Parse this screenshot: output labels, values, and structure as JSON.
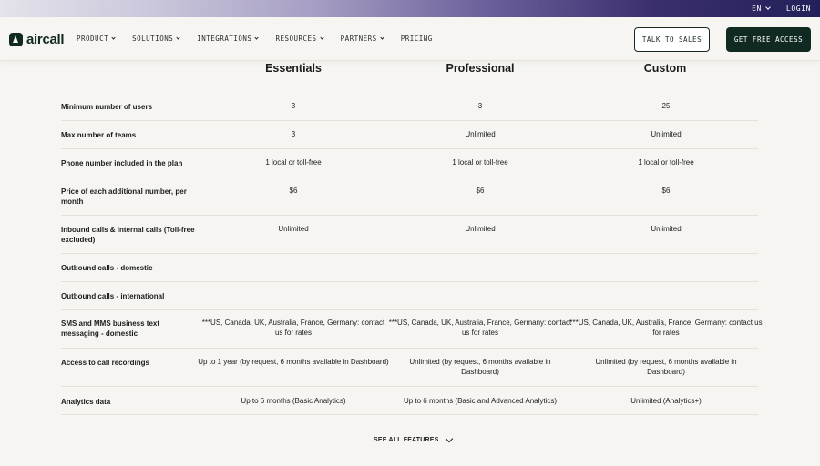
{
  "topbar": {
    "language": "EN",
    "login": "LOGIN"
  },
  "nav": {
    "logo_text": "aircall",
    "items": [
      {
        "label": "PRODUCT",
        "has_dropdown": true
      },
      {
        "label": "SOLUTIONS",
        "has_dropdown": true
      },
      {
        "label": "INTEGRATIONS",
        "has_dropdown": true
      },
      {
        "label": "RESOURCES",
        "has_dropdown": true
      },
      {
        "label": "PARTNERS",
        "has_dropdown": true
      },
      {
        "label": "PRICING",
        "has_dropdown": false
      }
    ],
    "talk_to_sales": "TALK TO SALES",
    "get_free_access": "GET FREE ACCESS"
  },
  "plans": [
    "Essentials",
    "Professional",
    "Custom"
  ],
  "rows": [
    {
      "label": "Minimum number of users",
      "values": [
        "3",
        "3",
        "25"
      ]
    },
    {
      "label": "Max number of teams",
      "values": [
        "3",
        "Unlimited",
        "Unlimited"
      ]
    },
    {
      "label": "Phone number included in the plan",
      "values": [
        "1 local or toll-free",
        "1 local or toll-free",
        "1 local or toll-free"
      ]
    },
    {
      "label": "Price of each additional number, per month",
      "values": [
        "$6",
        "$6",
        "$6"
      ]
    },
    {
      "label": "Inbound calls & internal calls (Toll-free excluded)",
      "values": [
        "Unlimited",
        "Unlimited",
        "Unlimited"
      ]
    },
    {
      "label": "Outbound calls - domestic",
      "values": [
        "",
        "",
        ""
      ]
    },
    {
      "label": "Outbound calls - international",
      "values": [
        "",
        "",
        ""
      ]
    },
    {
      "label": "SMS and MMS business text messaging - domestic",
      "values": [
        "***US, Canada, UK, Australia, France, Germany: contact us for rates",
        "***US, Canada, UK, Australia, France, Germany: contact us for rates",
        "***US, Canada, UK, Australia, France, Germany: contact us for rates"
      ]
    },
    {
      "label": "Access to call recordings",
      "values": [
        "Up to 1 year (by request, 6 months available in Dashboard)",
        "Unlimited (by request, 6 months available in Dashboard)",
        "Unlimited (by request, 6 months available in Dashboard)"
      ]
    },
    {
      "label": "Analytics data",
      "values": [
        "Up to 6 months (Basic Analytics)",
        "Up to 6 months (Basic and Advanced Analytics)",
        "Unlimited (Analytics+)"
      ]
    }
  ],
  "see_all": "SEE ALL FEATURES",
  "colors": {
    "brand_dark": "#102a22",
    "background": "#f6f5f1",
    "divider": "#e3e1da"
  }
}
